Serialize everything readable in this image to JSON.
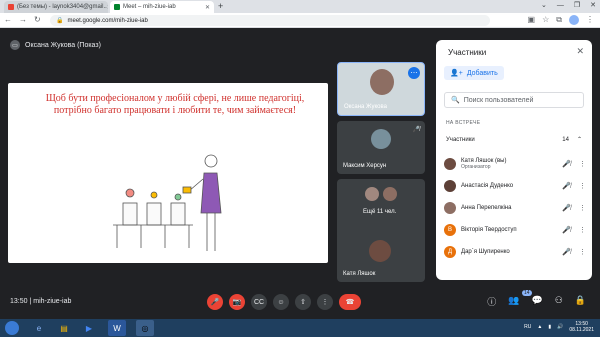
{
  "browser": {
    "tabs": [
      {
        "title": "(Без темы) - laynok3404@gmail..",
        "active": false
      },
      {
        "title": "Meet – mih-ziue-iab",
        "active": true
      }
    ],
    "url": "meet.google.com/mih-ziue-iab",
    "colors": {
      "tab_favicon_gmail": "#ea4335",
      "tab_favicon_meet": "#00832d"
    }
  },
  "meet": {
    "presenter_label": "Оксана Жукова (Показ)",
    "slide_text": "Щоб бути професіоналом у любій сфері, не лише педагогіці, потрібно  багато працювати і любити те, чим займаєтеся!",
    "tiles": [
      {
        "name": "Оксана Жукова"
      },
      {
        "name": "Максим Херсун"
      },
      {
        "name": "Ещё 11 чел."
      },
      {
        "name": "Катя Ляшок"
      }
    ],
    "time": "13:50",
    "meeting_code": "mih-ziue-iab",
    "participants_badge": "14"
  },
  "panel": {
    "title": "Участники",
    "add_label": "Добавить",
    "search_placeholder": "Поиск пользователей",
    "section_label": "НА ВСТРЕЧЕ",
    "group_label": "Участники",
    "group_count": "14",
    "participants": [
      {
        "name": "Катя Ляшок (вы)",
        "sub": "Организатор",
        "initial": "",
        "color": "#6d4c41"
      },
      {
        "name": "Анастасія Дуденко",
        "sub": "",
        "initial": "",
        "color": "#5d4037"
      },
      {
        "name": "Анна Перепелкіна",
        "sub": "",
        "initial": "",
        "color": "#8d6e63"
      },
      {
        "name": "Вікторія Твердоступ",
        "sub": "",
        "initial": "В",
        "color": "#e8710a"
      },
      {
        "name": "Дар`я Шупиренко",
        "sub": "",
        "initial": "Д",
        "color": "#e8710a"
      }
    ]
  },
  "taskbar": {
    "lang": "RU",
    "time": "13:50",
    "date": "08.11.2021"
  }
}
